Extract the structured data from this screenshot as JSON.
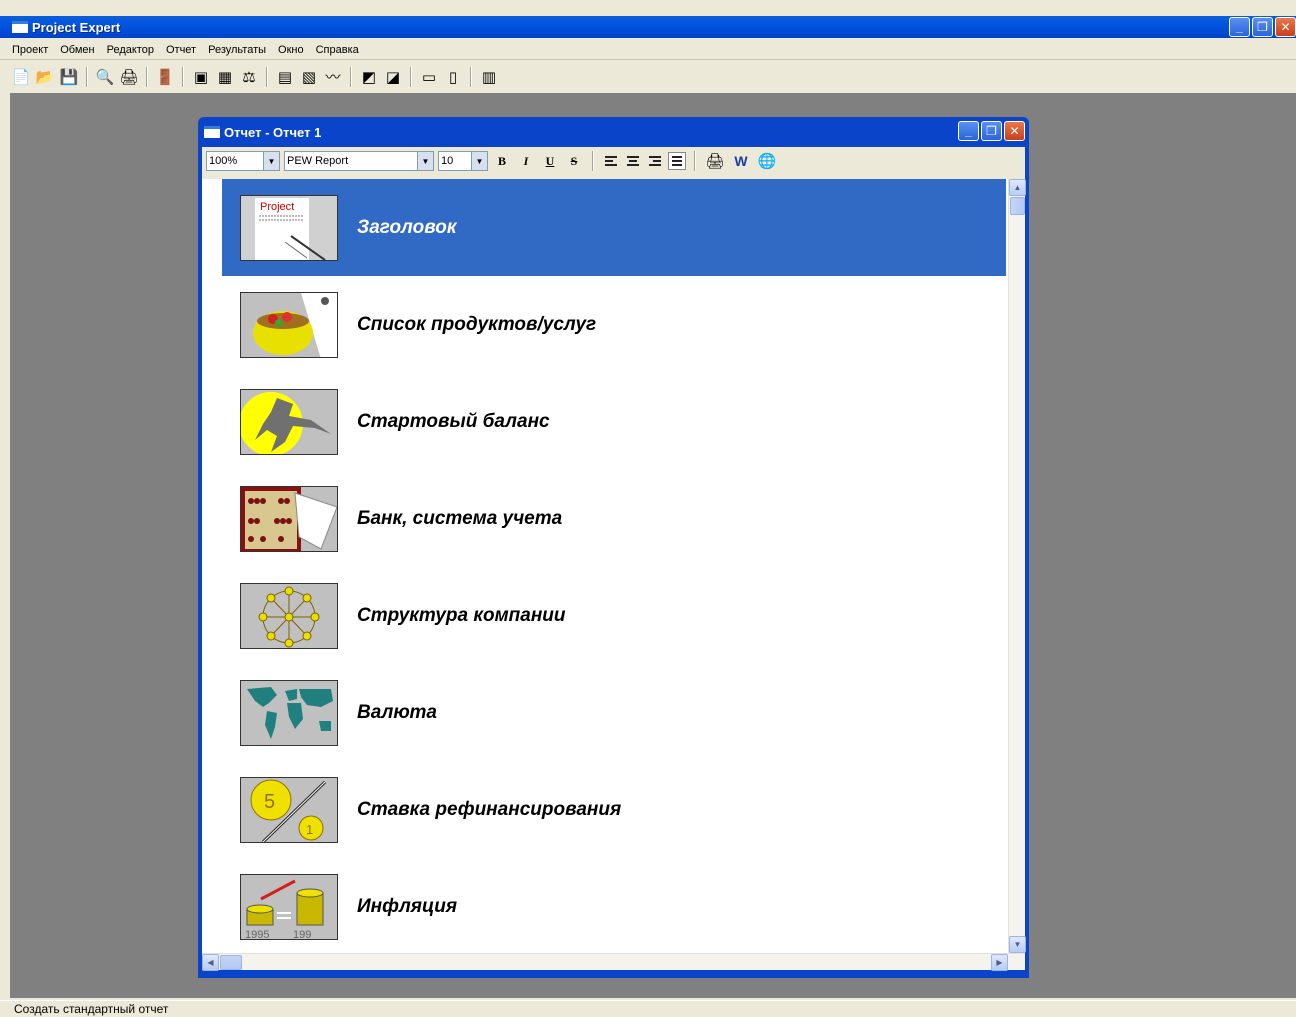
{
  "app": {
    "title": "Project Expert",
    "window_controls": {
      "minimize": "_",
      "restore": "❐",
      "close": "✕"
    }
  },
  "menu": [
    "Проект",
    "Обмен",
    "Редактор",
    "Отчет",
    "Результаты",
    "Окно",
    "Справка"
  ],
  "toolbar_icons": [
    "new-document-icon",
    "open-folder-icon",
    "save-icon",
    "print-preview-icon",
    "print-icon",
    "exit-icon",
    "project-icon",
    "chart-icon",
    "balance-icon",
    "table-icon",
    "report-icon",
    "graph-icon",
    "analysis-icon",
    "export-icon",
    "window-icon",
    "window2-icon",
    "calculator-icon"
  ],
  "child": {
    "title": "Отчет - Отчет 1",
    "zoom": "100%",
    "style": "PEW Report",
    "font_size": "10",
    "format": {
      "bold": "B",
      "italic": "I",
      "underline": "U",
      "strike": "S"
    }
  },
  "items": [
    {
      "label": "Заголовок",
      "icon": "title-page-icon",
      "thumb_text": "Project",
      "selected": true
    },
    {
      "label": "Список продуктов/услуг",
      "icon": "product-basket-icon",
      "selected": false
    },
    {
      "label": "Стартовый баланс",
      "icon": "runner-icon",
      "selected": false
    },
    {
      "label": "Банк, система учета",
      "icon": "abacus-icon",
      "selected": false
    },
    {
      "label": "Структура компании",
      "icon": "network-structure-icon",
      "selected": false
    },
    {
      "label": "Валюта",
      "icon": "world-map-icon",
      "selected": false
    },
    {
      "label": "Ставка рефинансирования",
      "icon": "coins-ratio-icon",
      "thumb_text_a": "5",
      "thumb_text_b": "1",
      "selected": false
    },
    {
      "label": "Инфляция",
      "icon": "coin-stacks-icon",
      "thumb_text_a": "1995",
      "thumb_text_b": "199_",
      "selected": false
    }
  ],
  "status": "Создать стандартный отчет",
  "colors": {
    "selection": "#316ac5",
    "title_blue": "#0a44c8",
    "workspace": "#808080"
  }
}
